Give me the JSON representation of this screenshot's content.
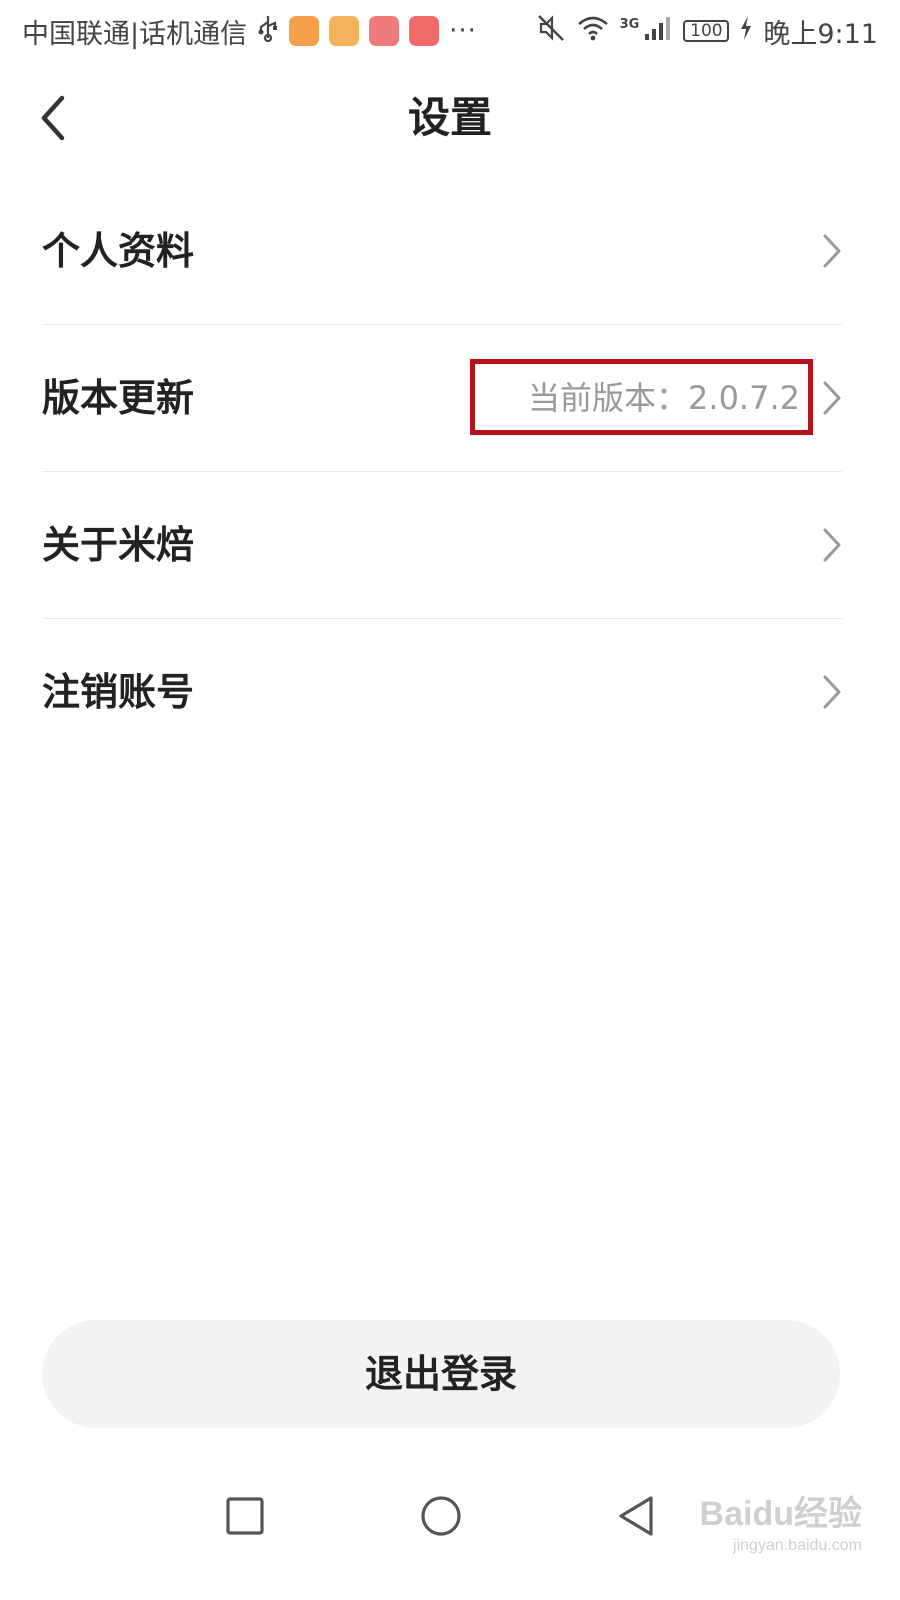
{
  "status_bar": {
    "carrier": "中国联通|话机通信",
    "more": "···",
    "network_type": "3G",
    "battery": "100",
    "time": "晚上9:11",
    "icons": [
      "usb-icon",
      "video-app-icon",
      "notes-app-icon",
      "huawei-store-icon",
      "huawei-wallet-icon",
      "mute-icon",
      "wifi-icon",
      "signal-icon",
      "charging-icon"
    ]
  },
  "header": {
    "title": "设置",
    "back_icon": "chevron-left-icon"
  },
  "settings": {
    "items": [
      {
        "label": "个人资料",
        "value": ""
      },
      {
        "label": "版本更新",
        "value": "当前版本：2.0.7.2"
      },
      {
        "label": "关于米焙",
        "value": ""
      },
      {
        "label": "注销账号",
        "value": ""
      }
    ],
    "chevron_icon": "chevron-right-icon"
  },
  "logout": {
    "label": "退出登录"
  },
  "nav_bar": {
    "icons": [
      "recents-square-icon",
      "home-circle-icon",
      "back-triangle-icon"
    ]
  },
  "watermark": {
    "main": "Baidu经验",
    "sub": "jingyan.baidu.com"
  },
  "colors": {
    "highlight": "#b5121b",
    "secondary_text": "#9a9a9a",
    "button_bg": "#f3f3f3",
    "divider": "#e8e8e8"
  }
}
